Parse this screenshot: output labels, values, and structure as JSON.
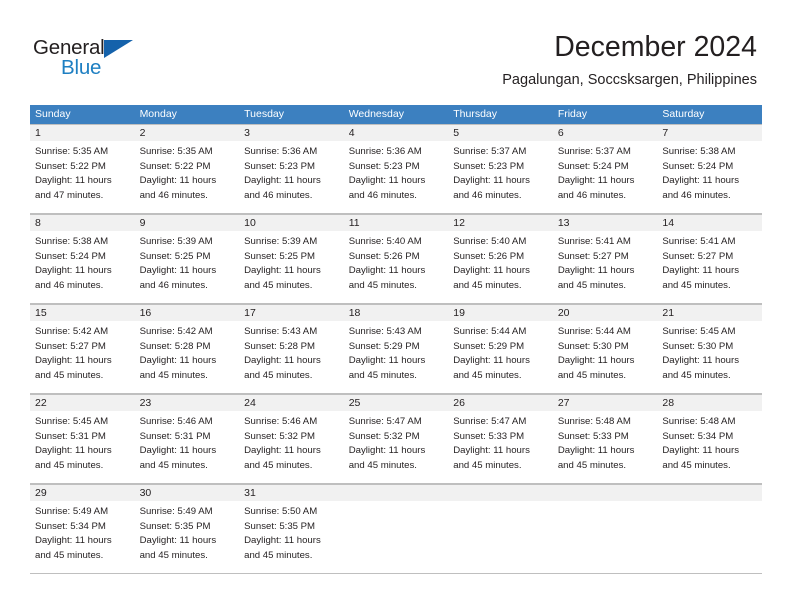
{
  "brand": {
    "name_part1": "General",
    "name_part2": "Blue",
    "triangle_icon": "brand-triangle-icon",
    "accent_color": "#1562ab",
    "blue_text_color": "#1e7fc2"
  },
  "header": {
    "title": "December 2024",
    "subtitle": "Pagalungan, Soccsksargen, Philippines"
  },
  "calendar": {
    "header_bg": "#3c80c0",
    "day_band_bg": "#f1f1f1",
    "border_color": "#bfbfbf",
    "weekdays": [
      "Sunday",
      "Monday",
      "Tuesday",
      "Wednesday",
      "Thursday",
      "Friday",
      "Saturday"
    ],
    "weeks": [
      [
        {
          "day": "1",
          "sunrise": "Sunrise: 5:35 AM",
          "sunset": "Sunset: 5:22 PM",
          "daylight1": "Daylight: 11 hours",
          "daylight2": "and 47 minutes."
        },
        {
          "day": "2",
          "sunrise": "Sunrise: 5:35 AM",
          "sunset": "Sunset: 5:22 PM",
          "daylight1": "Daylight: 11 hours",
          "daylight2": "and 46 minutes."
        },
        {
          "day": "3",
          "sunrise": "Sunrise: 5:36 AM",
          "sunset": "Sunset: 5:23 PM",
          "daylight1": "Daylight: 11 hours",
          "daylight2": "and 46 minutes."
        },
        {
          "day": "4",
          "sunrise": "Sunrise: 5:36 AM",
          "sunset": "Sunset: 5:23 PM",
          "daylight1": "Daylight: 11 hours",
          "daylight2": "and 46 minutes."
        },
        {
          "day": "5",
          "sunrise": "Sunrise: 5:37 AM",
          "sunset": "Sunset: 5:23 PM",
          "daylight1": "Daylight: 11 hours",
          "daylight2": "and 46 minutes."
        },
        {
          "day": "6",
          "sunrise": "Sunrise: 5:37 AM",
          "sunset": "Sunset: 5:24 PM",
          "daylight1": "Daylight: 11 hours",
          "daylight2": "and 46 minutes."
        },
        {
          "day": "7",
          "sunrise": "Sunrise: 5:38 AM",
          "sunset": "Sunset: 5:24 PM",
          "daylight1": "Daylight: 11 hours",
          "daylight2": "and 46 minutes."
        }
      ],
      [
        {
          "day": "8",
          "sunrise": "Sunrise: 5:38 AM",
          "sunset": "Sunset: 5:24 PM",
          "daylight1": "Daylight: 11 hours",
          "daylight2": "and 46 minutes."
        },
        {
          "day": "9",
          "sunrise": "Sunrise: 5:39 AM",
          "sunset": "Sunset: 5:25 PM",
          "daylight1": "Daylight: 11 hours",
          "daylight2": "and 46 minutes."
        },
        {
          "day": "10",
          "sunrise": "Sunrise: 5:39 AM",
          "sunset": "Sunset: 5:25 PM",
          "daylight1": "Daylight: 11 hours",
          "daylight2": "and 45 minutes."
        },
        {
          "day": "11",
          "sunrise": "Sunrise: 5:40 AM",
          "sunset": "Sunset: 5:26 PM",
          "daylight1": "Daylight: 11 hours",
          "daylight2": "and 45 minutes."
        },
        {
          "day": "12",
          "sunrise": "Sunrise: 5:40 AM",
          "sunset": "Sunset: 5:26 PM",
          "daylight1": "Daylight: 11 hours",
          "daylight2": "and 45 minutes."
        },
        {
          "day": "13",
          "sunrise": "Sunrise: 5:41 AM",
          "sunset": "Sunset: 5:27 PM",
          "daylight1": "Daylight: 11 hours",
          "daylight2": "and 45 minutes."
        },
        {
          "day": "14",
          "sunrise": "Sunrise: 5:41 AM",
          "sunset": "Sunset: 5:27 PM",
          "daylight1": "Daylight: 11 hours",
          "daylight2": "and 45 minutes."
        }
      ],
      [
        {
          "day": "15",
          "sunrise": "Sunrise: 5:42 AM",
          "sunset": "Sunset: 5:27 PM",
          "daylight1": "Daylight: 11 hours",
          "daylight2": "and 45 minutes."
        },
        {
          "day": "16",
          "sunrise": "Sunrise: 5:42 AM",
          "sunset": "Sunset: 5:28 PM",
          "daylight1": "Daylight: 11 hours",
          "daylight2": "and 45 minutes."
        },
        {
          "day": "17",
          "sunrise": "Sunrise: 5:43 AM",
          "sunset": "Sunset: 5:28 PM",
          "daylight1": "Daylight: 11 hours",
          "daylight2": "and 45 minutes."
        },
        {
          "day": "18",
          "sunrise": "Sunrise: 5:43 AM",
          "sunset": "Sunset: 5:29 PM",
          "daylight1": "Daylight: 11 hours",
          "daylight2": "and 45 minutes."
        },
        {
          "day": "19",
          "sunrise": "Sunrise: 5:44 AM",
          "sunset": "Sunset: 5:29 PM",
          "daylight1": "Daylight: 11 hours",
          "daylight2": "and 45 minutes."
        },
        {
          "day": "20",
          "sunrise": "Sunrise: 5:44 AM",
          "sunset": "Sunset: 5:30 PM",
          "daylight1": "Daylight: 11 hours",
          "daylight2": "and 45 minutes."
        },
        {
          "day": "21",
          "sunrise": "Sunrise: 5:45 AM",
          "sunset": "Sunset: 5:30 PM",
          "daylight1": "Daylight: 11 hours",
          "daylight2": "and 45 minutes."
        }
      ],
      [
        {
          "day": "22",
          "sunrise": "Sunrise: 5:45 AM",
          "sunset": "Sunset: 5:31 PM",
          "daylight1": "Daylight: 11 hours",
          "daylight2": "and 45 minutes."
        },
        {
          "day": "23",
          "sunrise": "Sunrise: 5:46 AM",
          "sunset": "Sunset: 5:31 PM",
          "daylight1": "Daylight: 11 hours",
          "daylight2": "and 45 minutes."
        },
        {
          "day": "24",
          "sunrise": "Sunrise: 5:46 AM",
          "sunset": "Sunset: 5:32 PM",
          "daylight1": "Daylight: 11 hours",
          "daylight2": "and 45 minutes."
        },
        {
          "day": "25",
          "sunrise": "Sunrise: 5:47 AM",
          "sunset": "Sunset: 5:32 PM",
          "daylight1": "Daylight: 11 hours",
          "daylight2": "and 45 minutes."
        },
        {
          "day": "26",
          "sunrise": "Sunrise: 5:47 AM",
          "sunset": "Sunset: 5:33 PM",
          "daylight1": "Daylight: 11 hours",
          "daylight2": "and 45 minutes."
        },
        {
          "day": "27",
          "sunrise": "Sunrise: 5:48 AM",
          "sunset": "Sunset: 5:33 PM",
          "daylight1": "Daylight: 11 hours",
          "daylight2": "and 45 minutes."
        },
        {
          "day": "28",
          "sunrise": "Sunrise: 5:48 AM",
          "sunset": "Sunset: 5:34 PM",
          "daylight1": "Daylight: 11 hours",
          "daylight2": "and 45 minutes."
        }
      ],
      [
        {
          "day": "29",
          "sunrise": "Sunrise: 5:49 AM",
          "sunset": "Sunset: 5:34 PM",
          "daylight1": "Daylight: 11 hours",
          "daylight2": "and 45 minutes."
        },
        {
          "day": "30",
          "sunrise": "Sunrise: 5:49 AM",
          "sunset": "Sunset: 5:35 PM",
          "daylight1": "Daylight: 11 hours",
          "daylight2": "and 45 minutes."
        },
        {
          "day": "31",
          "sunrise": "Sunrise: 5:50 AM",
          "sunset": "Sunset: 5:35 PM",
          "daylight1": "Daylight: 11 hours",
          "daylight2": "and 45 minutes."
        },
        {
          "day": "",
          "sunrise": "",
          "sunset": "",
          "daylight1": "",
          "daylight2": ""
        },
        {
          "day": "",
          "sunrise": "",
          "sunset": "",
          "daylight1": "",
          "daylight2": ""
        },
        {
          "day": "",
          "sunrise": "",
          "sunset": "",
          "daylight1": "",
          "daylight2": ""
        },
        {
          "day": "",
          "sunrise": "",
          "sunset": "",
          "daylight1": "",
          "daylight2": ""
        }
      ]
    ]
  }
}
